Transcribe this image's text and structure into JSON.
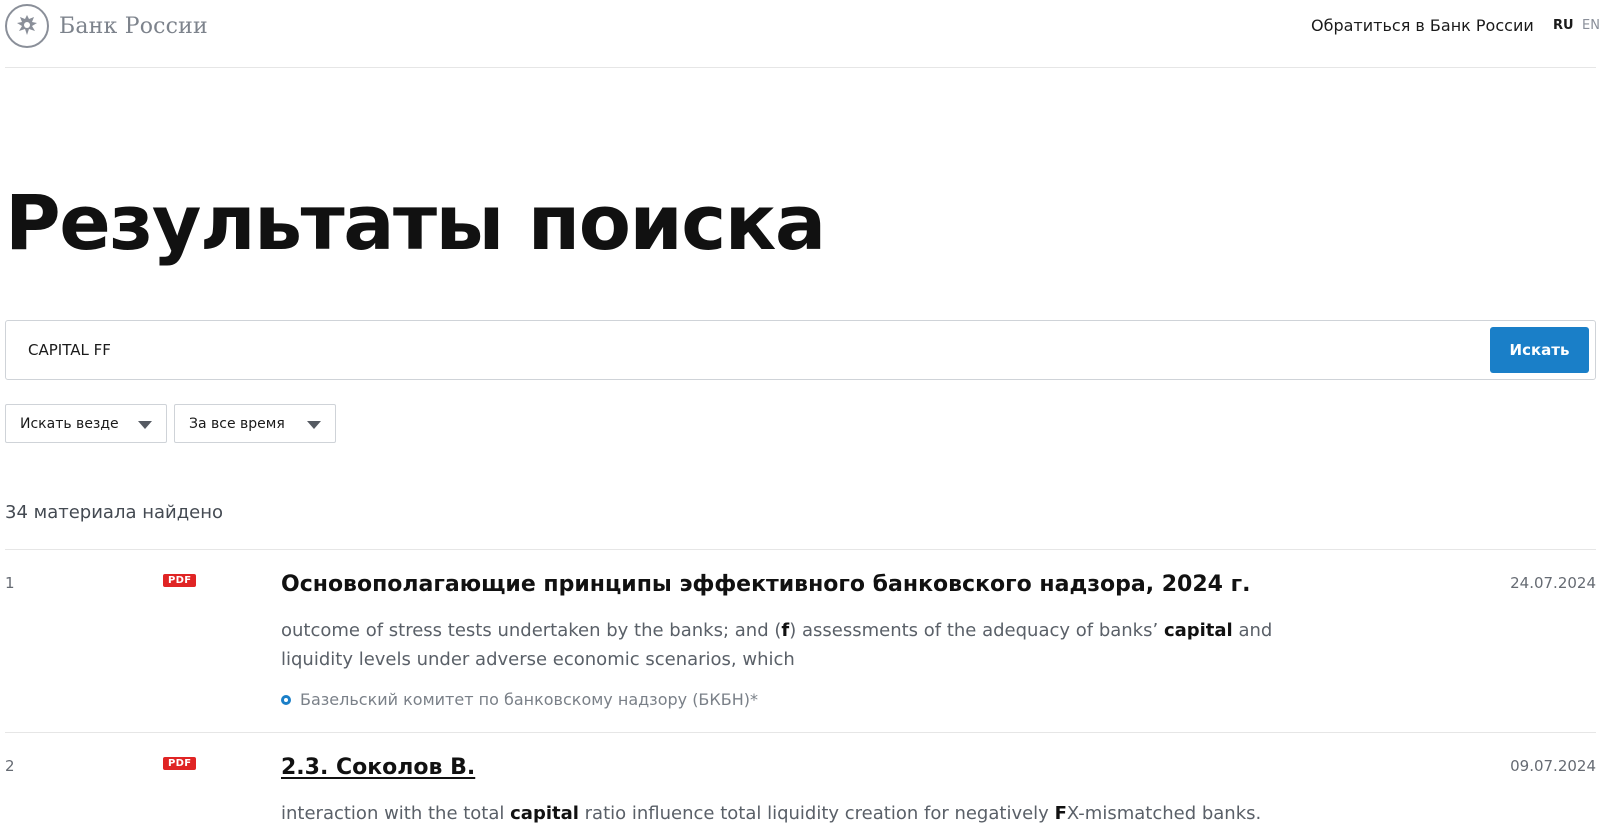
{
  "header": {
    "logo_text": "Банк России",
    "contact_link": "Обратиться в Банк России",
    "lang_ru": "RU",
    "lang_en": "EN"
  },
  "page": {
    "title": "Результаты поиска"
  },
  "search": {
    "value": "CAPITAL FF",
    "button_label": "Искать"
  },
  "filters": {
    "scope": "Искать везде",
    "period": "За все время"
  },
  "results_count": "34 материала найдено",
  "results": [
    {
      "number": "1",
      "badge": "PDF",
      "title": "Основополагающие принципы эффективного банковского надзора, 2024 г.",
      "date": "24.07.2024",
      "snippet": {
        "p1": "outcome of stress tests undertaken by the banks; and (",
        "h1": "f",
        "p2": ") assessments of the adequacy of banks’ ",
        "h2": "capital",
        "p3": " and liquidity levels under adverse economic scenarios, which"
      },
      "source": "Базельский комитет по банковскому надзору (БКБН)*"
    },
    {
      "number": "2",
      "badge": "PDF",
      "title": "2.3. Соколов В.",
      "date": "09.07.2024",
      "snippet": {
        "p1": "interaction with the total ",
        "h1": "capital",
        "p2": " ratio influence total liquidity creation for negatively ",
        "h2": "F",
        "p3": "X-mismatched banks."
      }
    }
  ],
  "colors": {
    "accent": "#1a7fc8",
    "pdf_badge": "#e02424"
  }
}
